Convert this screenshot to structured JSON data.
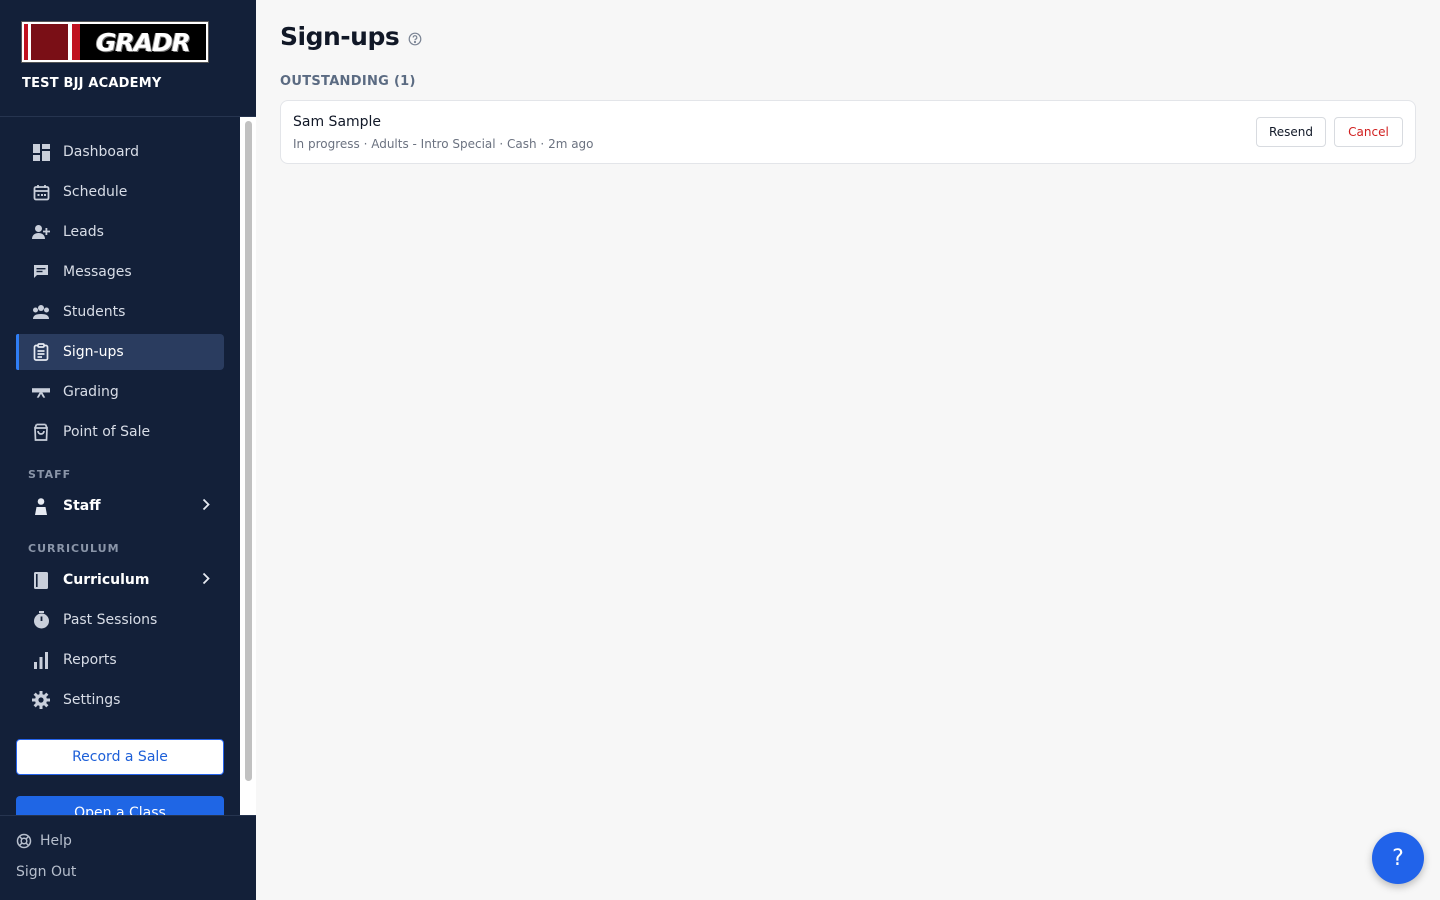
{
  "brand": {
    "logo_text": "GRADR",
    "academy": "TEST BJJ ACADEMY"
  },
  "nav": {
    "items": [
      {
        "label": "Dashboard",
        "icon": "dashboard-icon"
      },
      {
        "label": "Schedule",
        "icon": "calendar-icon"
      },
      {
        "label": "Leads",
        "icon": "person-add-icon"
      },
      {
        "label": "Messages",
        "icon": "chat-icon"
      },
      {
        "label": "Students",
        "icon": "group-icon"
      },
      {
        "label": "Sign-ups",
        "icon": "clipboard-icon",
        "active": true
      },
      {
        "label": "Grading",
        "icon": "belt-icon"
      },
      {
        "label": "Point of Sale",
        "icon": "shopping-bag-icon"
      }
    ],
    "staff_section": "STAFF",
    "staff_item": "Staff",
    "curriculum_section": "CURRICULUM",
    "curriculum_item": "Curriculum",
    "more_items": [
      {
        "label": "Past Sessions",
        "icon": "timer-icon"
      },
      {
        "label": "Reports",
        "icon": "bar-chart-icon"
      },
      {
        "label": "Settings",
        "icon": "gear-icon"
      }
    ],
    "record_sale": "Record a Sale",
    "open_class": "Open a Class"
  },
  "footer": {
    "help": "Help",
    "sign_out": "Sign Out"
  },
  "main": {
    "title": "Sign-ups",
    "section": "OUTSTANDING (1)",
    "signups": [
      {
        "name": "Sam Sample",
        "meta": "In progress · Adults - Intro Special · Cash · 2m ago",
        "resend": "Resend",
        "cancel": "Cancel"
      }
    ]
  },
  "fab": {
    "label": "?"
  },
  "colors": {
    "sidebar": "#132039",
    "accent": "#2563eb",
    "danger": "#d11f1f"
  }
}
